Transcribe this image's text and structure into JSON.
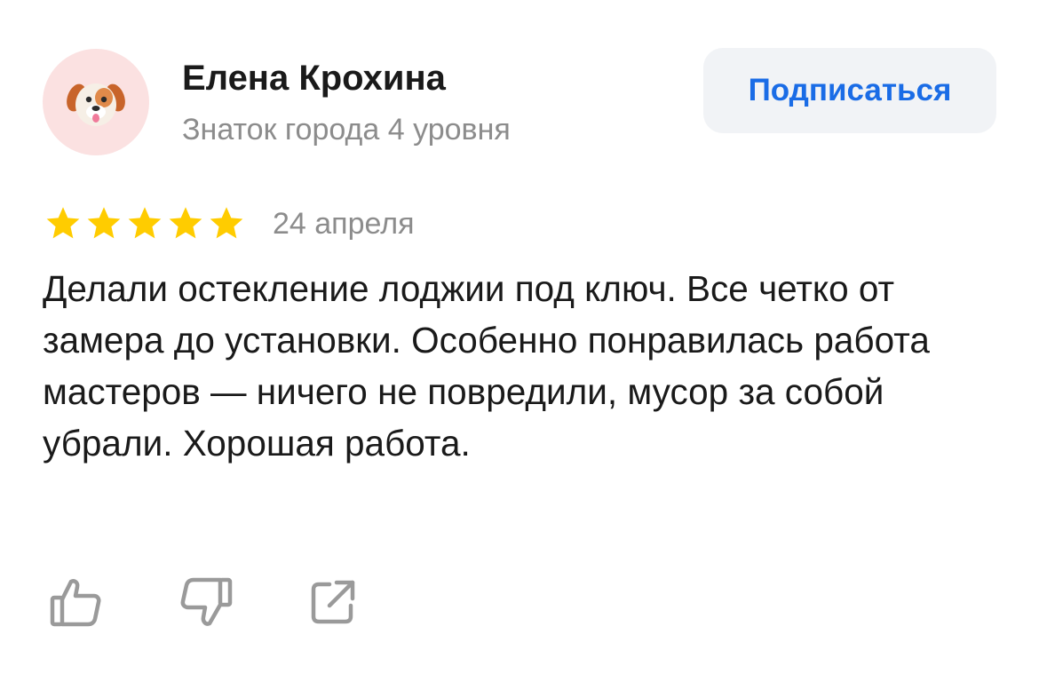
{
  "author": {
    "name": "Елена Крохина",
    "level": "Знаток города 4 уровня",
    "avatar_icon": "dog-face-emoji"
  },
  "subscribe_label": "Подписаться",
  "review": {
    "rating": 5,
    "rating_max": 5,
    "date": "24 апреля",
    "text": "Делали остекление лоджии под ключ. Все четко от замера до установки. Особенно понравилась работа мастеров — ничего не повредили, мусор за собой убрали. Хорошая работа."
  },
  "actions": [
    {
      "icon": "thumbs-up-icon"
    },
    {
      "icon": "thumbs-down-icon"
    },
    {
      "icon": "share-icon"
    }
  ],
  "colors": {
    "accent": "#1a6ce6",
    "star": "#ffcc00",
    "secondary_text": "#8c8c8c",
    "avatar_bg": "#fbe1e1",
    "button_bg": "#f1f3f6",
    "icon": "#9a9a9a"
  }
}
